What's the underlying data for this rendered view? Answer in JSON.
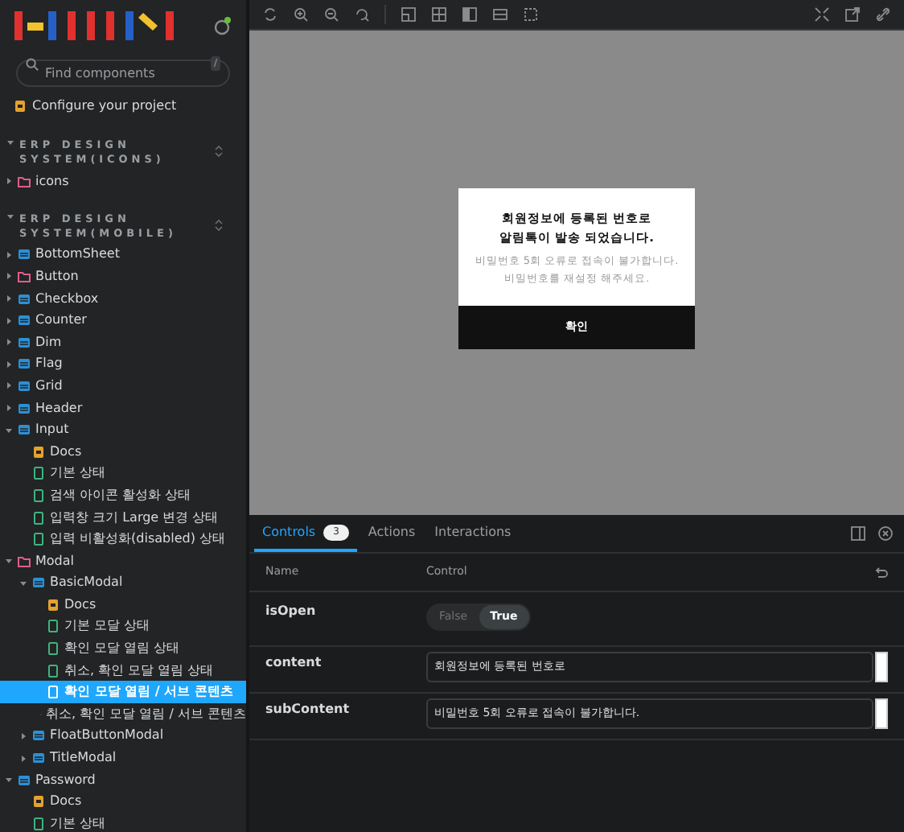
{
  "sidebar": {
    "search": {
      "placeholder": "Find components",
      "shortcut": "/"
    },
    "configure": "Configure your project",
    "sections": [
      {
        "title": "ERP DESIGN SYSTEM(ICONS)",
        "items": [
          {
            "label": "icons",
            "kind": "folder",
            "expanded": false,
            "selected": false
          }
        ]
      },
      {
        "title": "ERP DESIGN SYSTEM(MOBILE)",
        "items": [
          {
            "label": "BottomSheet",
            "kind": "component",
            "expanded": false,
            "selected": false
          },
          {
            "label": "Button",
            "kind": "folder",
            "expanded": false,
            "selected": false
          },
          {
            "label": "Checkbox",
            "kind": "component",
            "expanded": false,
            "selected": false
          },
          {
            "label": "Counter",
            "kind": "component",
            "expanded": false,
            "selected": false
          },
          {
            "label": "Dim",
            "kind": "component",
            "expanded": false,
            "selected": false
          },
          {
            "label": "Flag",
            "kind": "component",
            "expanded": false,
            "selected": false
          },
          {
            "label": "Grid",
            "kind": "component",
            "expanded": false,
            "selected": false
          },
          {
            "label": "Header",
            "kind": "component",
            "expanded": false,
            "selected": false
          },
          {
            "label": "Input",
            "kind": "component",
            "expanded": true,
            "selected": false,
            "children": [
              {
                "label": "Docs",
                "kind": "docs",
                "selected": false
              },
              {
                "label": "기본 상태",
                "kind": "story",
                "selected": false
              },
              {
                "label": "검색 아이콘 활성화 상태",
                "kind": "story",
                "selected": false
              },
              {
                "label": "입력창 크기 Large 변경 상태",
                "kind": "story",
                "selected": false
              },
              {
                "label": "입력 비활성화(disabled) 상태",
                "kind": "story",
                "selected": false
              }
            ]
          },
          {
            "label": "Modal",
            "kind": "folder",
            "expanded": true,
            "selected": false,
            "children": [
              {
                "label": "BasicModal",
                "kind": "component",
                "expanded": true,
                "selected": false,
                "children": [
                  {
                    "label": "Docs",
                    "kind": "docs",
                    "selected": false
                  },
                  {
                    "label": "기본 모달 상태",
                    "kind": "story",
                    "selected": false
                  },
                  {
                    "label": "확인 모달 열림 상태",
                    "kind": "story",
                    "selected": false
                  },
                  {
                    "label": "취소, 확인 모달 열림 상태",
                    "kind": "story",
                    "selected": false
                  },
                  {
                    "label": "확인 모달 열림 / 서브 콘텐츠",
                    "kind": "story",
                    "selected": true
                  },
                  {
                    "label": "취소, 확인 모달 열림 / 서브 콘텐츠",
                    "kind": "story",
                    "selected": false
                  }
                ]
              },
              {
                "label": "FloatButtonModal",
                "kind": "component",
                "expanded": false,
                "selected": false
              },
              {
                "label": "TitleModal",
                "kind": "component",
                "expanded": false,
                "selected": false
              }
            ]
          },
          {
            "label": "Password",
            "kind": "component",
            "expanded": true,
            "selected": false,
            "children": [
              {
                "label": "Docs",
                "kind": "docs",
                "selected": false
              },
              {
                "label": "기본 상태",
                "kind": "story",
                "selected": false
              }
            ]
          }
        ]
      }
    ]
  },
  "modal": {
    "title": "회원정보에 등록된 번호로\n알림톡이 발송 되었습니다.",
    "sub": "비밀번호 5회 오류로 접속이 불가합니다.\n비밀번호를 재설정 해주세요.",
    "button": "확인"
  },
  "panel": {
    "tabs": [
      {
        "label": "Controls",
        "badge": "3",
        "selected": true
      },
      {
        "label": "Actions",
        "selected": false
      },
      {
        "label": "Interactions",
        "selected": false
      }
    ],
    "columns": [
      "Name",
      "Control"
    ],
    "rows": [
      {
        "name": "isOpen",
        "kind": "boolean",
        "options": [
          {
            "label": "False",
            "selected": false
          },
          {
            "label": "True",
            "selected": true
          }
        ]
      },
      {
        "name": "content",
        "kind": "text",
        "value": "회원정보에 등록된 번호로"
      },
      {
        "name": "subContent",
        "kind": "text",
        "value": "비밀번호 5회 오류로 접속이 불가합니다."
      }
    ]
  }
}
